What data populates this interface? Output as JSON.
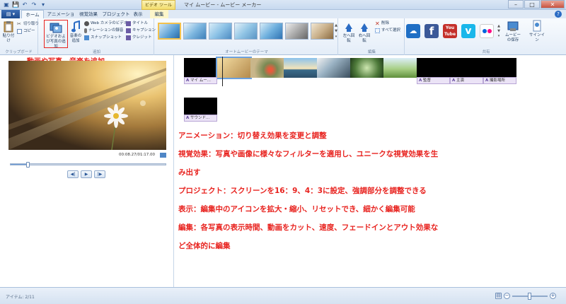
{
  "title_bar": {
    "title": "マイ ムービー - ムービー メーカー",
    "context_tab": "ビデオ ツール"
  },
  "tabs": [
    {
      "label": "ホーム",
      "active": true
    },
    {
      "label": "アニメーション",
      "active": false
    },
    {
      "label": "視覚効果",
      "active": false
    },
    {
      "label": "プロジェクト",
      "active": false
    },
    {
      "label": "表示",
      "active": false
    },
    {
      "label": "編集",
      "active": false
    }
  ],
  "ribbon": {
    "clipboard": {
      "paste": "貼り付け",
      "cut": "切り取り",
      "copy": "コピー",
      "label": "クリップボード"
    },
    "add": {
      "add_media": "ビデオおよび写真の追加",
      "add_music": "音楽の追加",
      "webcam": "Web カメラのビデオ",
      "narration": "ナレーションの録音",
      "snapshot": "スナップショット",
      "title": "タイトル",
      "caption": "キャプション",
      "credits": "クレジット",
      "label": "追加"
    },
    "themes_label": "オートムービーのテーマ",
    "edit": {
      "rotate_left": "左へ回転",
      "rotate_right": "右へ回転",
      "remove": "削除",
      "select_all": "すべて選択",
      "label": "編集"
    },
    "share": {
      "save_movie": "ムービーの保存",
      "sign_in": "サインイン",
      "label": "共有",
      "services": [
        "skydrive",
        "facebook",
        "youtube",
        "vimeo",
        "flickr"
      ]
    }
  },
  "preview": {
    "hint": "動画や写真、音楽を追加",
    "timecode": "00:08.27/01:17.00",
    "progress": 0.11
  },
  "storyboard": {
    "captions_row1": [
      "マイ ムー..."
    ],
    "captions_row1_right": [
      "監督",
      "主演",
      "撮影場所"
    ],
    "sound_caption": "サウンド..."
  },
  "descriptions": [
    "アニメーション：切り替え効果を変更と調整",
    "視覚効果：写真や画像に様々なフィルターを適用し、ユニークな視覚効果を生",
    "み出す",
    "プロジェクト：スクリーンを16：9、4：3に設定、強調部分を調整できる",
    "表示：編集中のアイコンを拡大・縮小、リセットでき、細かく編集可能",
    "編集：各写真の表示時間、動画をカット、速度、フェードインとアウト効果な",
    "ど全体的に編集"
  ],
  "status": {
    "items": "アイテム: 2/11",
    "zoom": 0.5
  }
}
